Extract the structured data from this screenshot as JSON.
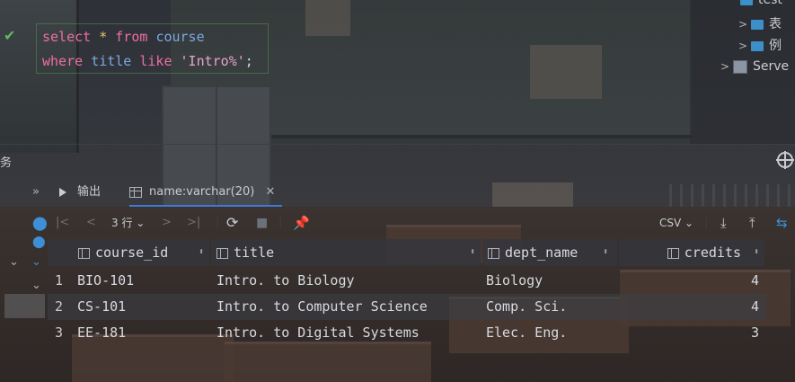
{
  "editor": {
    "line1": {
      "kw1": "select",
      "star": "*",
      "kw2": "from",
      "ident": "course"
    },
    "line2": {
      "kw1": "where",
      "ident": "title",
      "kw2": "like",
      "str": "'Intro%'",
      "semi": ";"
    }
  },
  "tree": {
    "items": [
      {
        "label": "test"
      },
      {
        "label": "表"
      },
      {
        "label": "例"
      },
      {
        "label": "Serve"
      }
    ]
  },
  "side_label": "务",
  "tabs": [
    {
      "label": "输出"
    },
    {
      "label": "name:varchar(20)"
    }
  ],
  "toolbar": {
    "rows_label": "3 行",
    "export_format": "CSV"
  },
  "table": {
    "columns": [
      "course_id",
      "title",
      "dept_name",
      "credits"
    ],
    "rows": [
      {
        "num": "1",
        "course_id": "BIO-101",
        "title": "Intro. to Biology",
        "dept_name": "Biology",
        "credits": "4"
      },
      {
        "num": "2",
        "course_id": "CS-101",
        "title": "Intro. to Computer Science",
        "dept_name": "Comp. Sci.",
        "credits": "4"
      },
      {
        "num": "3",
        "course_id": "EE-181",
        "title": "Intro. to Digital Systems",
        "dept_name": "Elec. Eng.",
        "credits": "3"
      }
    ]
  },
  "colors": {
    "keyword": "#ee6fa0",
    "identifier": "#7aa9e0",
    "string": "#e7a2d1",
    "accent": "#3d7bd6",
    "success": "#5fb865"
  }
}
